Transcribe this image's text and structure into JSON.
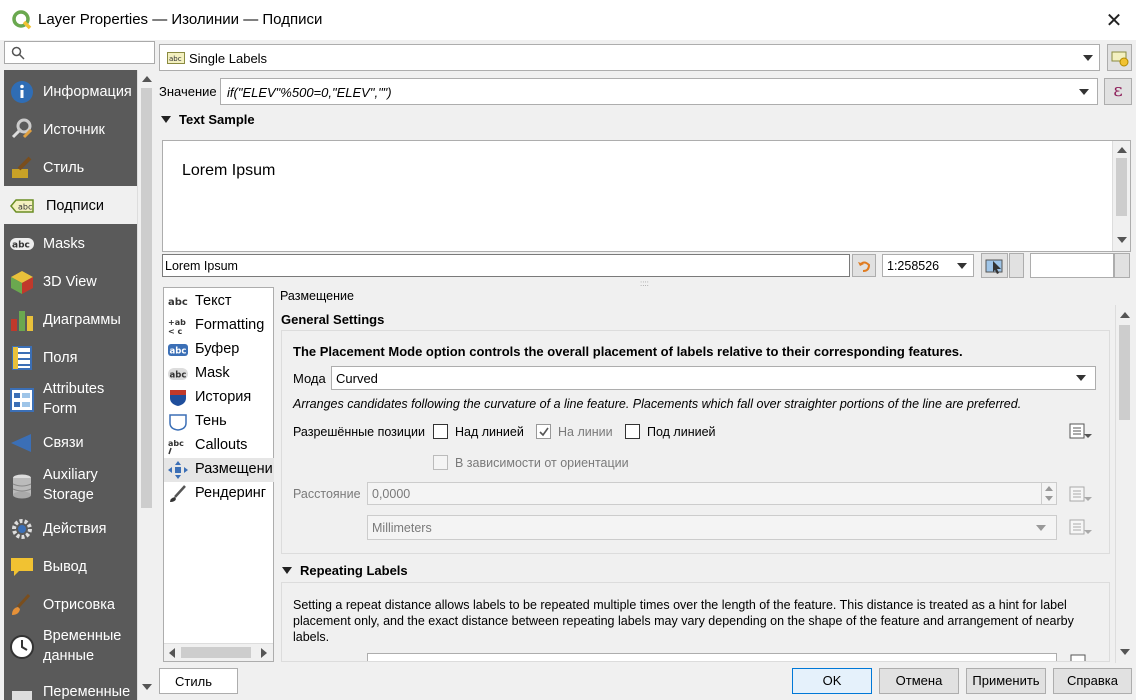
{
  "window": {
    "title": "Layer Properties — Изолинии — Подписи"
  },
  "sidebar": {
    "search_placeholder": "",
    "items": [
      {
        "label": "Информация",
        "icon": "info-icon"
      },
      {
        "label": "Источник",
        "icon": "source-icon"
      },
      {
        "label": "Стиль",
        "icon": "style-brush-icon"
      },
      {
        "label": "Подписи",
        "icon": "labels-abc-icon"
      },
      {
        "label": "Masks",
        "icon": "masks-icon"
      },
      {
        "label": "3D View",
        "icon": "cube-icon"
      },
      {
        "label": "Диаграммы",
        "icon": "diagram-icon"
      },
      {
        "label": "Поля",
        "icon": "fields-icon"
      },
      {
        "label": "Attributes Form",
        "icon": "form-icon"
      },
      {
        "label": "Связи",
        "icon": "joins-icon"
      },
      {
        "label": "Auxiliary Storage",
        "icon": "database-icon"
      },
      {
        "label": "Действия",
        "icon": "actions-gear-icon"
      },
      {
        "label": "Вывод",
        "icon": "speech-bubble-icon"
      },
      {
        "label": "Отрисовка",
        "icon": "paintbrush-icon"
      },
      {
        "label": "Временные данные",
        "icon": "clock-icon"
      },
      {
        "label": "Переменные",
        "icon": "variables-icon"
      }
    ]
  },
  "labeling": {
    "mode": "Single Labels",
    "value_label": "Значение",
    "expression": "if(\"ELEV\"%500=0,\"ELEV\",\"\")"
  },
  "text_sample": {
    "header": "Text Sample",
    "preview": "Lorem Ipsum",
    "input_value": "Lorem Ipsum",
    "scale": "1:258526"
  },
  "tabs": [
    {
      "label": "Текст",
      "icon": "text-abc-icon"
    },
    {
      "label": "Formatting",
      "icon": "formatting-icon"
    },
    {
      "label": "Буфер",
      "icon": "buffer-icon"
    },
    {
      "label": "Mask",
      "icon": "mask-icon"
    },
    {
      "label": "История",
      "icon": "background-shield-icon"
    },
    {
      "label": "Тень",
      "icon": "shadow-icon"
    },
    {
      "label": "Callouts",
      "icon": "callouts-icon"
    },
    {
      "label": "Размещени",
      "icon": "placement-icon"
    },
    {
      "label": "Рендеринг",
      "icon": "rendering-icon"
    }
  ],
  "placement": {
    "section_label": "Размещение",
    "general_header": "General Settings",
    "intro": "The Placement Mode option controls the overall placement of labels relative to their corresponding features.",
    "mode_label": "Мода",
    "mode_value": "Curved",
    "mode_description": "Arranges candidates following the curvature of a line feature. Placements which fall over straighter portions of the line are preferred.",
    "allowed_label": "Разрешённые позиции",
    "above_label": "Над линией",
    "on_label": "На линии",
    "below_label": "Под линией",
    "orientation_label": "В зависимости от ориентации",
    "distance_label": "Расстояние",
    "distance_value": "0,0000",
    "unit_value": "Millimeters",
    "repeat_header": "Repeating Labels",
    "repeat_text": "Setting a repeat distance allows labels to be repeated multiple times over the length of the feature. This distance is treated as a hint for label placement only, and the exact distance between repeating labels may vary depending on the shape of the feature and arrangement of nearby labels."
  },
  "footer": {
    "style_label": "Стиль",
    "ok": "OK",
    "cancel": "Отмена",
    "apply": "Применить",
    "help": "Справка"
  },
  "colors": {
    "accent": "#0078d7",
    "sidebar_bg": "#5a5a5a"
  }
}
